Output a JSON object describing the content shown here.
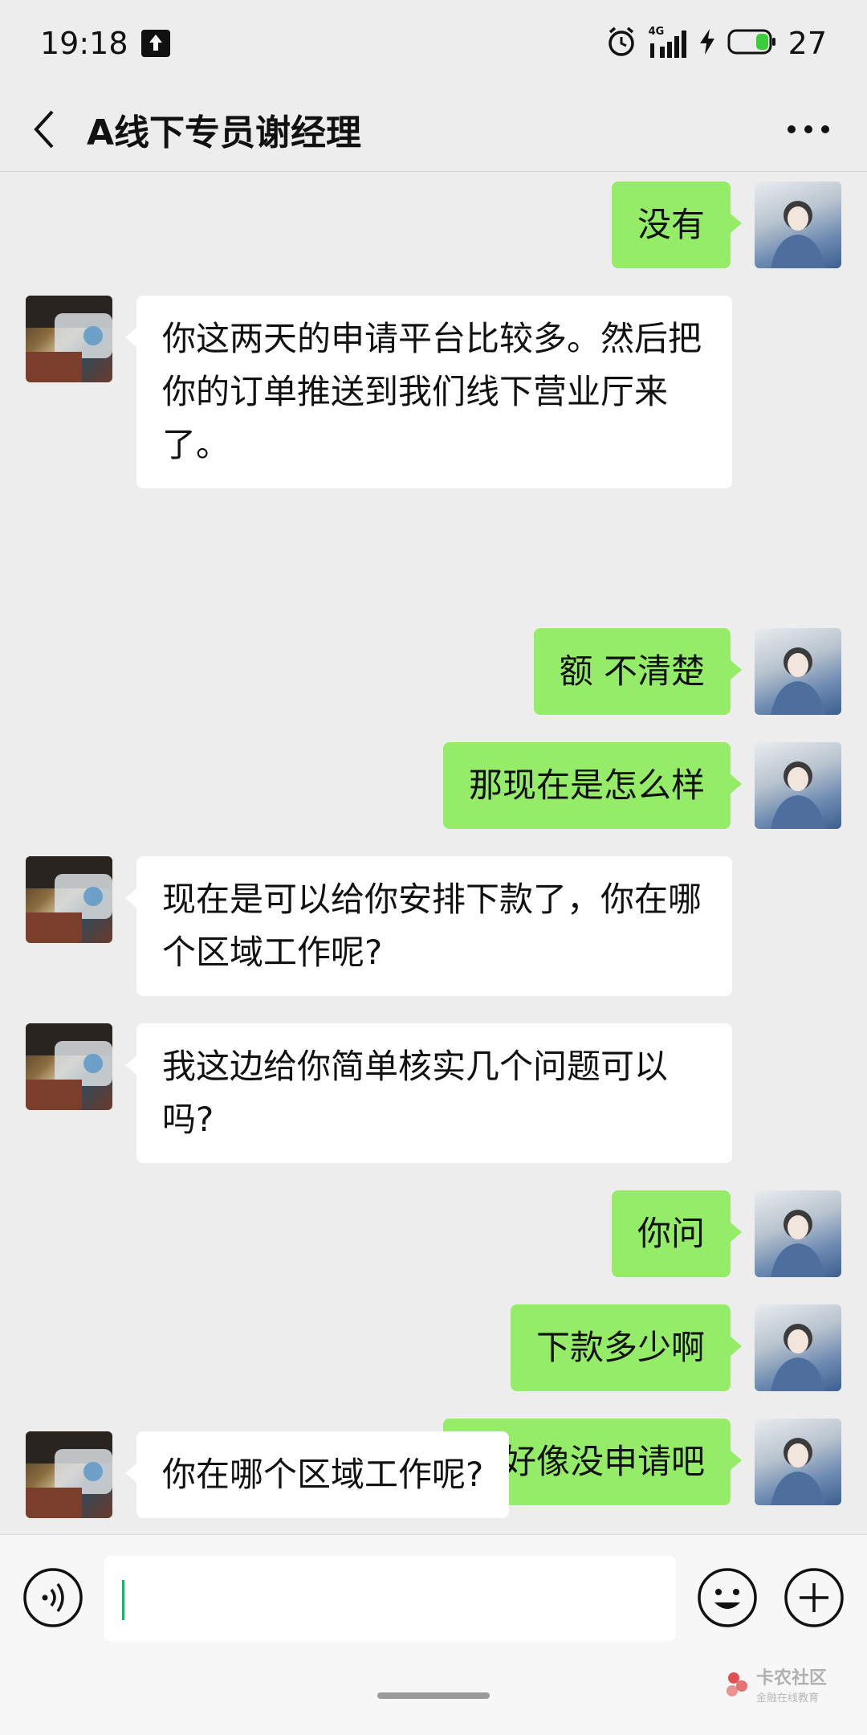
{
  "status_bar": {
    "time": "19:18",
    "network": "4G",
    "battery": "27",
    "icons": [
      "upload-icon",
      "alarm-icon",
      "signal-icon",
      "charging-icon",
      "battery-icon"
    ]
  },
  "header": {
    "title": "A线下专员谢经理",
    "back_icon": "chevron-left-icon",
    "more_icon": "more-icon"
  },
  "messages": [
    {
      "side": "me",
      "text": "没有"
    },
    {
      "side": "other",
      "text": "你这两天的申请平台比较多。然后把你的订单推送到我们线下营业厅来了。"
    },
    {
      "side": "me",
      "text": "额 不清楚"
    },
    {
      "side": "me",
      "text": "那现在是怎么样"
    },
    {
      "side": "other",
      "text": "现在是可以给你安排下款了，你在哪个区域工作呢?"
    },
    {
      "side": "other",
      "text": "我这边给你简单核实几个问题可以吗?"
    },
    {
      "side": "me",
      "text": "你问"
    },
    {
      "side": "me",
      "text": "下款多少啊"
    },
    {
      "side": "me",
      "text": "我好像没申请吧"
    },
    {
      "side": "other",
      "text": "你在哪个区域工作呢?"
    }
  ],
  "input_bar": {
    "value": "",
    "voice_icon": "voice-icon",
    "emoji_icon": "emoji-icon",
    "plus_icon": "plus-icon"
  },
  "watermark": {
    "main": "卡农社区",
    "sub": "金融在线教育"
  },
  "colors": {
    "my_bubble": "#95ec69",
    "their_bubble": "#ffffff",
    "background": "#ededed",
    "caret": "#07c160"
  }
}
